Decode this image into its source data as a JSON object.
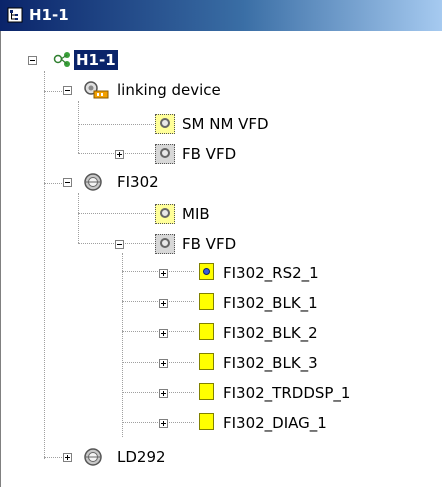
{
  "window": {
    "title": "H1-1",
    "title_icon": "tree-document-icon"
  },
  "tree": {
    "root": {
      "label": "H1-1",
      "icon": "network-icon",
      "selected": true
    },
    "linking_device": {
      "label": "linking device",
      "icon": "linking-device-icon",
      "children": [
        "SM NM VFD",
        "FB VFD"
      ]
    },
    "fi302": {
      "label": "FI302",
      "icon": "gauge-device-icon",
      "mib": "MIB",
      "fb_vfd": "FB VFD",
      "blocks": [
        "FI302_RS2_1",
        "FI302_BLK_1",
        "FI302_BLK_2",
        "FI302_BLK_3",
        "FI302_TRDDSP_1",
        "FI302_DIAG_1"
      ]
    },
    "ld292": {
      "label": "LD292",
      "icon": "gauge-device-icon"
    }
  },
  "colors": {
    "title_bar": "#0a246a",
    "selection": "#0a246a",
    "block_fill": "#ffff00"
  }
}
